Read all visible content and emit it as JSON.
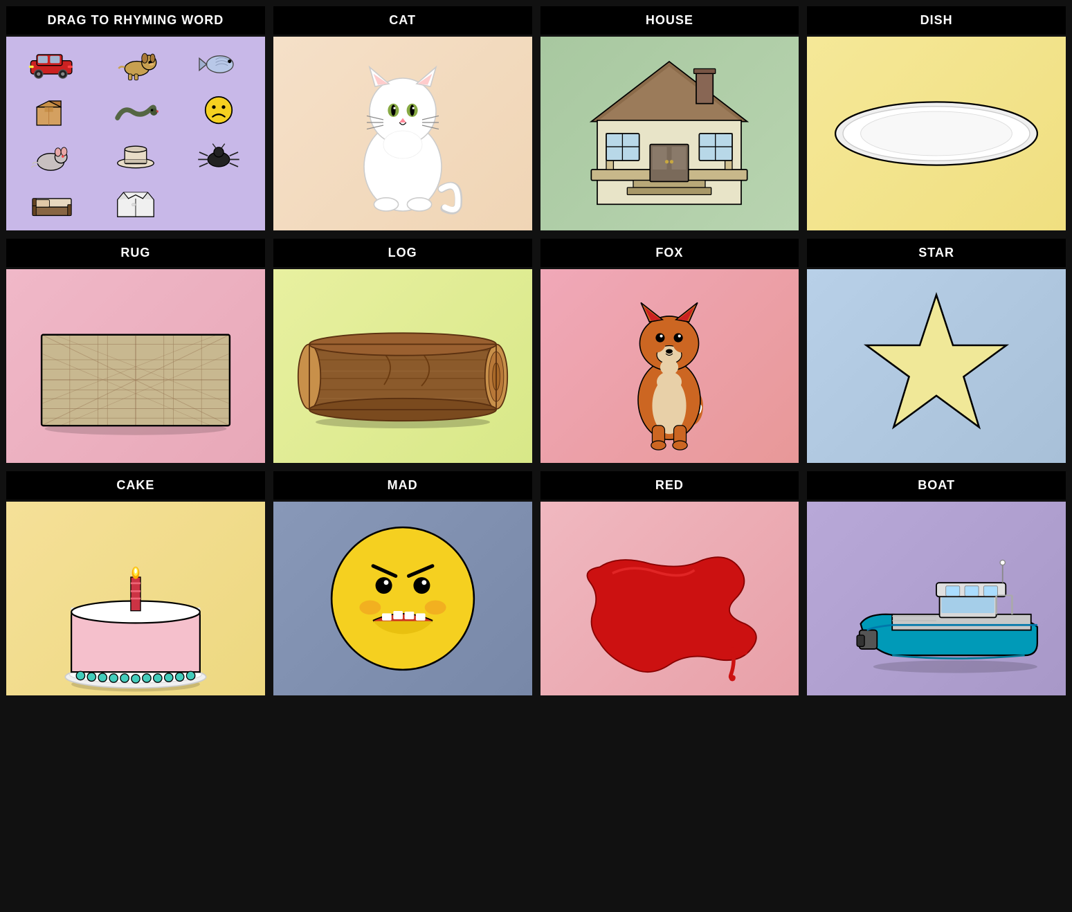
{
  "cells": [
    {
      "id": "drag-source",
      "header": "DRAG TO RHYMING WORD",
      "bg": "bg-lavender",
      "type": "drag-items"
    },
    {
      "id": "cat",
      "header": "CAT",
      "bg": "bg-peach-light",
      "type": "cat"
    },
    {
      "id": "house",
      "header": "HOUSE",
      "bg": "bg-sage",
      "type": "house"
    },
    {
      "id": "dish",
      "header": "DISH",
      "bg": "bg-yellow-light",
      "type": "dish"
    },
    {
      "id": "rug",
      "header": "RUG",
      "bg": "bg-pink-light",
      "type": "rug"
    },
    {
      "id": "log",
      "header": "LOG",
      "bg": "bg-yellow-green",
      "type": "log"
    },
    {
      "id": "fox",
      "header": "FOX",
      "bg": "bg-pink-red",
      "type": "fox"
    },
    {
      "id": "star",
      "header": "STAR",
      "bg": "bg-blue-light",
      "type": "star"
    },
    {
      "id": "cake",
      "header": "CAKE",
      "bg": "bg-yellow-warm",
      "type": "cake"
    },
    {
      "id": "mad",
      "header": "MAD",
      "bg": "bg-blue-gray",
      "type": "mad"
    },
    {
      "id": "red",
      "header": "RED",
      "bg": "bg-pink-soft",
      "type": "red"
    },
    {
      "id": "boat",
      "header": "BOAT",
      "bg": "bg-purple-light",
      "type": "boat"
    }
  ]
}
